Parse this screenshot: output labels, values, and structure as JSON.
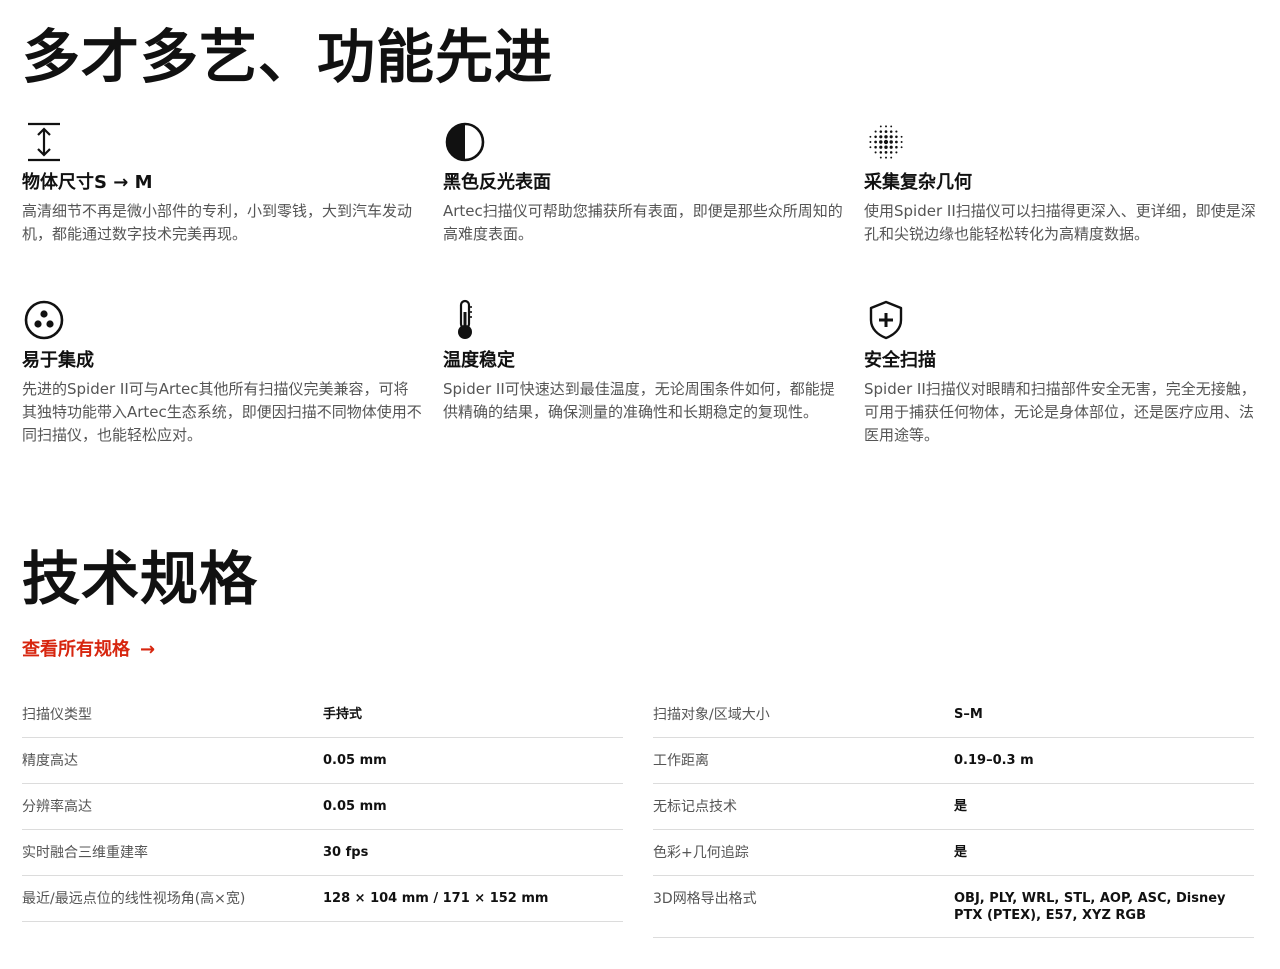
{
  "section1": {
    "title": "多才多艺、功能先进"
  },
  "features": [
    {
      "icon": "vertical-size-arrows-icon",
      "title": "物体尺寸S → M",
      "desc": "高清细节不再是微小部件的专利，小到零钱，大到汽车发动机，都能通过数字技术完美再现。"
    },
    {
      "icon": "half-circle-contrast-icon",
      "title": "黑色反光表面",
      "desc": "Artec扫描仪可帮助您捕获所有表面，即便是那些众所周知的高难度表面。"
    },
    {
      "icon": "dot-sphere-icon",
      "title": "采集复杂几何",
      "desc": "使用Spider II扫描仪可以扫描得更深入、更详细，即使是深孔和尖锐边缘也能轻松转化为高精度数据。"
    },
    {
      "icon": "three-dots-circle-icon",
      "title": "易于集成",
      "desc": "先进的Spider II可与Artec其他所有扫描仪完美兼容，可将其独特功能带入Artec生态系统，即便因扫描不同物体使用不同扫描仪，也能轻松应对。"
    },
    {
      "icon": "thermometer-icon",
      "title": "温度稳定",
      "desc": "Spider II可快速达到最佳温度，无论周围条件如何，都能提供精确的结果，确保测量的准确性和长期稳定的复现性。"
    },
    {
      "icon": "shield-plus-icon",
      "title": "安全扫描",
      "desc": "Spider II扫描仪对眼睛和扫描部件安全无害，完全无接触，可用于捕获任何物体，无论是身体部位，还是医疗应用、法医用途等。"
    }
  ],
  "section2": {
    "title": "技术规格",
    "link_label": "查看所有规格",
    "link_arrow": "→"
  },
  "specs_left": [
    {
      "key": "扫描仪类型",
      "value": "手持式"
    },
    {
      "key": "精度高达",
      "value": "0.05 mm"
    },
    {
      "key": "分辨率高达",
      "value": "0.05 mm"
    },
    {
      "key": "实时融合三维重建率",
      "value": "30 fps"
    },
    {
      "key": "最近/最远点位的线性视场角(高×宽)",
      "value": "128 × 104 mm / 171 × 152 mm"
    }
  ],
  "specs_right": [
    {
      "key": "扫描对象/区域大小",
      "value": "S–M"
    },
    {
      "key": "工作距离",
      "value": "0.19–0.3 m"
    },
    {
      "key": "无标记点技术",
      "value": "是"
    },
    {
      "key": "色彩+几何追踪",
      "value": "是"
    },
    {
      "key": "3D网格导出格式",
      "value": "OBJ, PLY, WRL, STL, AOP, ASC, Disney PTX (PTEX), E57, XYZ RGB"
    }
  ],
  "colors": {
    "accent": "#d7260f",
    "text": "#111111",
    "muted": "#555555",
    "divider": "#dcdcdc"
  }
}
